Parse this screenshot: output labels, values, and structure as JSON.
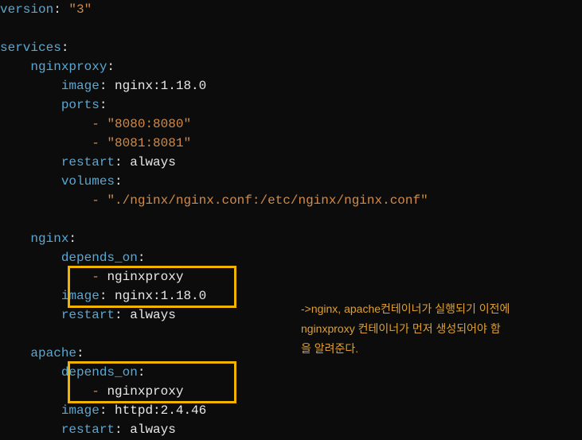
{
  "code": {
    "l1_key": "version",
    "l1_val": "\"3\"",
    "l3_key": "services",
    "l4_key": "nginxproxy",
    "l5_key": "image",
    "l5_val": "nginx:1.18.0",
    "l6_key": "ports",
    "l7_val": "\"8080:8080\"",
    "l8_val": "\"8081:8081\"",
    "l9_key": "restart",
    "l9_val": "always",
    "l10_key": "volumes",
    "l11_val": "\"./nginx/nginx.conf:/etc/nginx/nginx.conf\"",
    "l13_key": "nginx",
    "l14_key": "depends_on",
    "l15_val": "nginxproxy",
    "l16_key": "image",
    "l16_val": "nginx:1.18.0",
    "l17_key": "restart",
    "l17_val": "always",
    "l19_key": "apache",
    "l20_key": "depends_on",
    "l21_val": "nginxproxy",
    "l22_key": "image",
    "l22_val": "httpd:2.4.46",
    "l23_key": "restart",
    "l23_val": "always",
    "dash": "-"
  },
  "annotation": {
    "line1": "->nginx, apache컨테이너가 실행되기 이전에",
    "line2": "nginxproxy 컨테이너가 먼저 생성되어야 함",
    "line3": "을 알려준다."
  }
}
